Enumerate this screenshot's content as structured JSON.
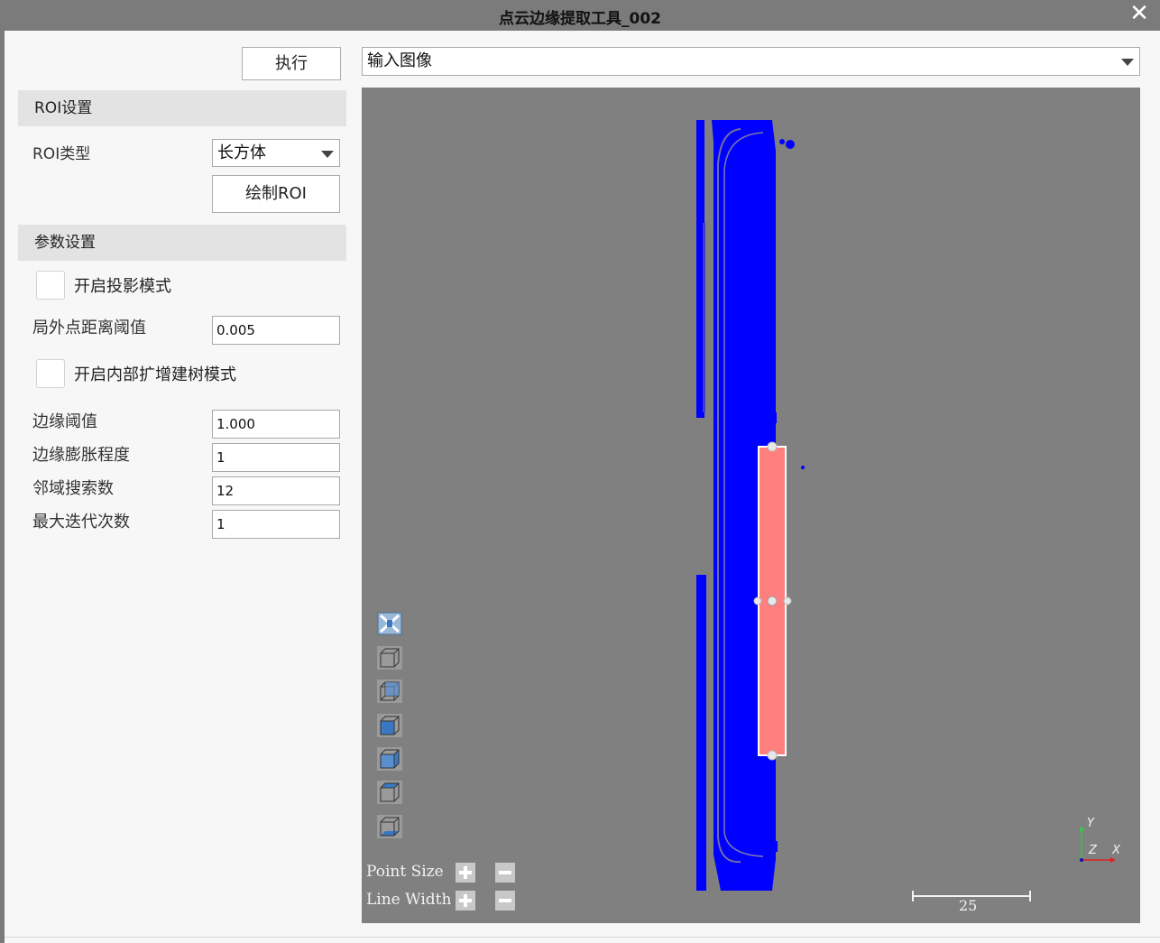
{
  "window": {
    "title": "点云边缘提取工具_002",
    "close_icon": "close-icon"
  },
  "toolbar": {
    "execute_label": "执行",
    "image_select_value": "输入图像"
  },
  "roi": {
    "section_title": "ROI设置",
    "type_label": "ROI类型",
    "type_value": "长方体",
    "draw_button": "绘制ROI"
  },
  "params": {
    "section_title": "参数设置",
    "projection_mode_label": "开启投影模式",
    "projection_mode_checked": false,
    "outlier_threshold_label": "局外点距离阈值",
    "outlier_threshold_value": "0.005",
    "region_grow_label": "开启内部扩增建树模式",
    "region_grow_checked": false,
    "edge_threshold_label": "边缘阈值",
    "edge_threshold_value": "1.000",
    "edge_dilation_label": "边缘膨胀程度",
    "edge_dilation_value": "1",
    "neighbor_count_label": "邻域搜索数",
    "neighbor_count_value": "12",
    "max_iter_label": "最大迭代次数",
    "max_iter_value": "1"
  },
  "viewer": {
    "point_size_label": "Point Size",
    "line_width_label": "Line Width",
    "scale_bar_value": "25",
    "axis_labels": {
      "y": "Y",
      "z": "Z",
      "x": "X"
    },
    "colors": {
      "background": "#808080",
      "point_cloud": "#0000ff",
      "roi_fill": "#ff7f7f",
      "roi_border": "#ffffff"
    },
    "tool_icons": [
      "fit-view-icon",
      "front-view-icon",
      "back-view-icon",
      "left-view-icon",
      "right-view-icon",
      "top-view-icon",
      "bottom-view-icon"
    ]
  }
}
